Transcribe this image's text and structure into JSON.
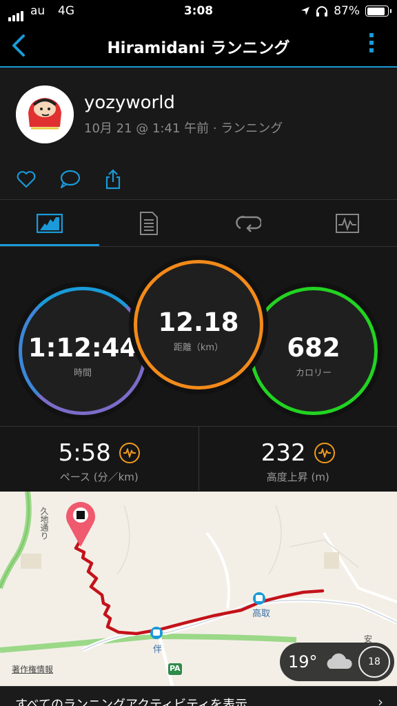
{
  "status_bar": {
    "carrier": "au",
    "network": "4G",
    "time": "3:08",
    "battery": "87%"
  },
  "nav": {
    "title": "Hiramidani ランニング",
    "back_icon": "chevron-left-icon",
    "more_icon": "more-vertical-icon"
  },
  "profile": {
    "username": "yozyworld",
    "subtitle": "10月 21 @ 1:41 午前 · ランニング"
  },
  "actions": [
    "heart-icon",
    "comment-icon",
    "share-icon"
  ],
  "tabs": [
    "overview-icon",
    "details-icon",
    "laps-icon",
    "charts-icon"
  ],
  "rings": {
    "time": {
      "value": "1:12:44",
      "label": "時間",
      "color": "#7b6cc9"
    },
    "distance": {
      "value": "12.18",
      "label": "距離（km）",
      "color": "#f28a1a"
    },
    "calories": {
      "value": "682",
      "label": "カロリー",
      "color": "#22d322"
    }
  },
  "stats": [
    {
      "value": "5:58",
      "label": "ペース (分／km)"
    },
    {
      "value": "232",
      "label": "高度上昇 (m)"
    }
  ],
  "map": {
    "labels": {
      "road": "久地通り",
      "station1": "高取",
      "station2": "伴",
      "pa": "PA",
      "copyright": "著作権情報",
      "corner": "安"
    },
    "weather": {
      "temp": "19°",
      "aqi": "18"
    },
    "route_color": "#c4121a"
  },
  "footer": {
    "text": "すべてのランニングアクティビティを表示"
  },
  "colors": {
    "accent": "#1a9ad8",
    "elevation_badge": "#f29b1d"
  }
}
